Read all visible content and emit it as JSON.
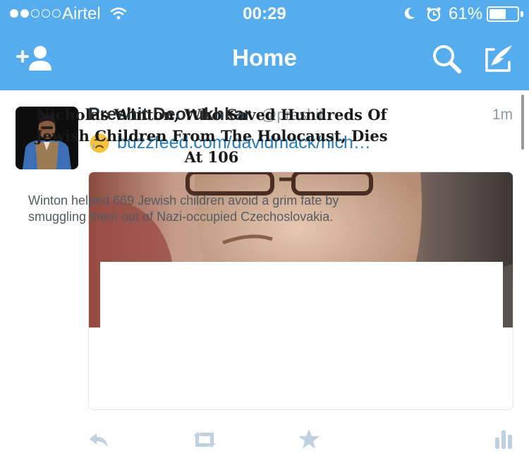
{
  "status_bar": {
    "carrier": "Airtel",
    "signal_bars": 2,
    "signal_total": 5,
    "time": "00:29",
    "battery_percent": "61%",
    "battery_level": 0.61
  },
  "nav": {
    "title": "Home",
    "icons": [
      "add-user-icon",
      "search-icon",
      "compose-icon"
    ]
  },
  "tweet": {
    "author_name": "Preshit Deorukhkar",
    "author_handle": "@preshit",
    "time_ago": "1m",
    "emoji": "crying-face",
    "link_text": "buzzfeed.com/davidmack/nich…",
    "card": {
      "headline": "Nicholas Winton, Who Saved Hundreds Of Jewish Children From The Holocaust, Dies At 106",
      "description": "Winton helped 669 Jewish children avoid a grim fate by smuggling them out of Nazi-occupied Czechoslovakia."
    },
    "actions": [
      "reply-icon",
      "retweet-icon",
      "favorite-icon",
      "stats-icon"
    ]
  },
  "colors": {
    "accent": "#55acee",
    "link": "#2b7bb9",
    "muted": "#8899a6",
    "action_icon": "#bfd1e0"
  }
}
